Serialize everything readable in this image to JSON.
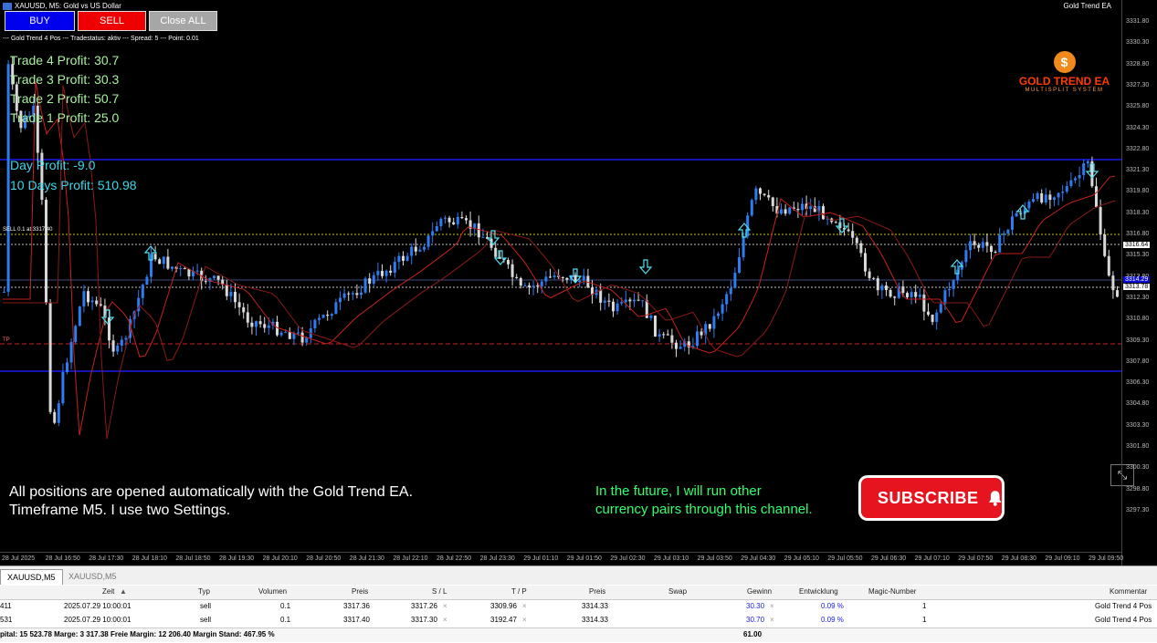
{
  "window": {
    "symbol_title": "XAUUSD, M5:  Gold vs US Dollar",
    "ea_name": "Gold Trend EA"
  },
  "buttons": {
    "buy": "BUY",
    "sell": "SELL",
    "close_all": "Close ALL"
  },
  "status_line": "--- Gold Trend 4 Pos --- Tradestatus: aktiv --- Spread: 5 --- Point: 0.01",
  "trades": [
    {
      "label": "Trade 4 Profit: 30.7"
    },
    {
      "label": "Trade 3 Profit: 30.3"
    },
    {
      "label": "Trade 2 Profit: 50.7"
    },
    {
      "label": "Trade 1 Profit: 25.0"
    }
  ],
  "day_profit": "Day Profit: -9.0",
  "ten_days_profit": "10 Days Profit: 510.98",
  "logo": {
    "name": "GOLD TREND EA",
    "tagline": "MULTISPLIT SYSTEM",
    "coin": "$"
  },
  "chart_labels": {
    "tp": "TP",
    "sell_line": "SELL 0.1 at 3317.40"
  },
  "overlay_text": {
    "line1": "All positions are opened automatically with the Gold Trend EA.",
    "line2": "Timeframe M5. I use two Settings.",
    "future1": "In the future, I will run other",
    "future2": "currency pairs through this channel."
  },
  "subscribe": {
    "label": "SUBSCRIBE",
    "icon": "bell-icon"
  },
  "price_axis": {
    "ticks": [
      "3331.80",
      "3330.30",
      "3328.80",
      "3327.30",
      "3325.80",
      "3324.30",
      "3322.80",
      "3321.30",
      "3319.80",
      "3318.30",
      "3316.80",
      "3315.30",
      "3313.80",
      "3312.30",
      "3310.80",
      "3309.30",
      "3307.80",
      "3306.30",
      "3304.80",
      "3303.30",
      "3301.80",
      "3300.30",
      "3298.80",
      "3297.30"
    ],
    "current_price": "3316.64",
    "label2": "3314.29",
    "label3": "3313.78"
  },
  "time_axis": {
    "ticks": [
      "28 Jul 2025",
      "28 Jul 16:50",
      "28 Jul 17:30",
      "28 Jul 18:10",
      "28 Jul 18:50",
      "28 Jul 19:30",
      "28 Jul 20:10",
      "28 Jul 20:50",
      "28 Jul 21:30",
      "28 Jul 22:10",
      "28 Jul 22:50",
      "28 Jul 23:30",
      "29 Jul 01:10",
      "29 Jul 01:50",
      "29 Jul 02:30",
      "29 Jul 03:10",
      "29 Jul 03:50",
      "29 Jul 04:30",
      "29 Jul 05:10",
      "29 Jul 05:50",
      "29 Jul 06:30",
      "29 Jul 07:10",
      "29 Jul 07:50",
      "29 Jul 08:30",
      "29 Jul 09:10",
      "29 Jul 09:50"
    ]
  },
  "tabs": [
    {
      "label": "XAUUSD,M5",
      "active": true
    },
    {
      "label": "XAUUSD,M5",
      "active": false
    }
  ],
  "table": {
    "headers": [
      "Zeit",
      "Typ",
      "Volumen",
      "Preis",
      "S / L",
      "T / P",
      "Preis",
      "Swap",
      "Gewinn",
      "Entwicklung",
      "Magic-Number",
      "Kommentar"
    ],
    "rows": [
      {
        "ticket": "411",
        "time": "2025.07.29 10:00:01",
        "type": "sell",
        "volume": "0.1",
        "price": "3317.36",
        "sl": "3317.26",
        "tp": "3309.96",
        "cur_price": "3314.33",
        "swap": "",
        "profit": "30.30",
        "dev": "0.09 %",
        "magic": "1",
        "comment": "Gold Trend 4 Pos"
      },
      {
        "ticket": "531",
        "time": "2025.07.29 10:00:01",
        "type": "sell",
        "volume": "0.1",
        "price": "3317.40",
        "sl": "3317.30",
        "tp": "3192.47",
        "cur_price": "3314.33",
        "swap": "",
        "profit": "30.70",
        "dev": "0.09 %",
        "magic": "1",
        "comment": "Gold Trend 4 Pos"
      }
    ],
    "summary": "pital: 15 523.78  Marge: 3 317.38  Freie Margin: 12 206.40  Margin Stand: 467.95 %",
    "summary_total": "61.00"
  },
  "colors": {
    "bull": "#2d7cf0",
    "bear": "#d8d8d8",
    "ma": "#c4211e",
    "level_line": "#1b1bf0",
    "arrow": "#4fe0f0"
  }
}
